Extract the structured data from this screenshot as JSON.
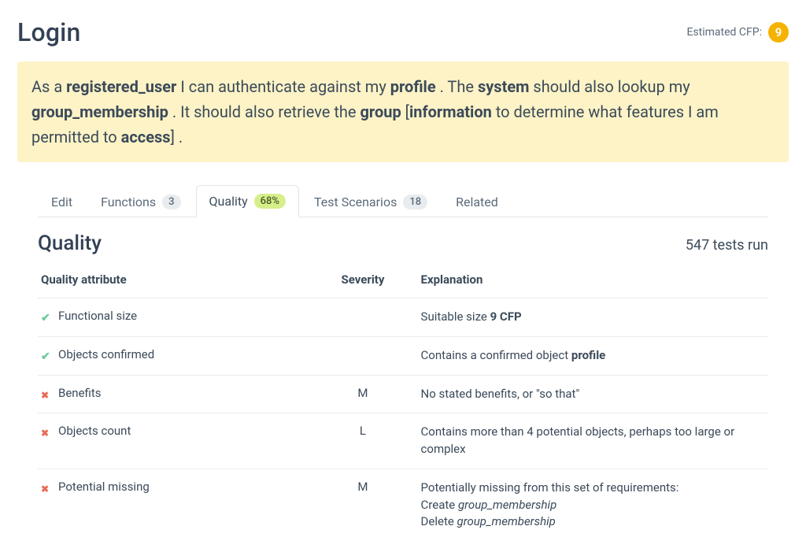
{
  "header": {
    "title": "Login",
    "cfpLabel": "Estimated CFP:",
    "cfpValue": "9"
  },
  "story": {
    "parts": [
      {
        "text": "As a ",
        "bold": false
      },
      {
        "text": "registered_user",
        "bold": true
      },
      {
        "text": " I can authenticate against my ",
        "bold": false
      },
      {
        "text": "profile",
        "bold": true
      },
      {
        "text": " . The ",
        "bold": false
      },
      {
        "text": "system",
        "bold": true
      },
      {
        "text": " should also lookup my ",
        "bold": false
      },
      {
        "text": "group_membership",
        "bold": true
      },
      {
        "text": " . It should also retrieve the ",
        "bold": false
      },
      {
        "text": "group",
        "bold": true
      },
      {
        "text": " [",
        "bold": false
      },
      {
        "text": "information",
        "bold": true
      },
      {
        "text": " to determine what features I am permitted to ",
        "bold": false
      },
      {
        "text": "access",
        "bold": true
      },
      {
        "text": "] .",
        "bold": false
      }
    ]
  },
  "tabs": [
    {
      "label": "Edit",
      "badge": null,
      "active": false
    },
    {
      "label": "Functions",
      "badge": "3",
      "badgeStyle": "grey",
      "active": false
    },
    {
      "label": "Quality",
      "badge": "68%",
      "badgeStyle": "green",
      "active": true
    },
    {
      "label": "Test Scenarios",
      "badge": "18",
      "badgeStyle": "grey",
      "active": false
    },
    {
      "label": "Related",
      "badge": null,
      "active": false
    }
  ],
  "quality": {
    "sectionTitle": "Quality",
    "testsRun": "547 tests run",
    "columns": {
      "attribute": "Quality attribute",
      "severity": "Severity",
      "explanation": "Explanation"
    },
    "rows": [
      {
        "icon": "check",
        "attribute": "Functional size",
        "severity": "",
        "explanation": [
          {
            "text": "Suitable size ",
            "bold": false
          },
          {
            "text": "9 CFP",
            "bold": true
          }
        ]
      },
      {
        "icon": "check",
        "attribute": "Objects confirmed",
        "severity": "",
        "explanation": [
          {
            "text": "Contains a confirmed object ",
            "bold": false
          },
          {
            "text": "profile",
            "bold": true
          }
        ]
      },
      {
        "icon": "cross",
        "attribute": "Benefits",
        "severity": "M",
        "explanation": [
          {
            "text": "No stated benefits, or \"so that\"",
            "bold": false
          }
        ]
      },
      {
        "icon": "cross",
        "attribute": "Objects count",
        "severity": "L",
        "explanation": [
          {
            "text": "Contains more than 4 potential objects, perhaps too large or complex",
            "bold": false
          }
        ]
      },
      {
        "icon": "cross",
        "attribute": "Potential missing",
        "severity": "M",
        "explanation": [
          {
            "text": "Potentially missing from this set of requirements:",
            "bold": false
          },
          {
            "text": "\n",
            "break": true
          },
          {
            "text": "Create ",
            "bold": false
          },
          {
            "text": "group_membership",
            "italic": true
          },
          {
            "text": "\n",
            "break": true
          },
          {
            "text": "Delete ",
            "bold": false
          },
          {
            "text": "group_membership",
            "italic": true
          }
        ]
      }
    ]
  }
}
